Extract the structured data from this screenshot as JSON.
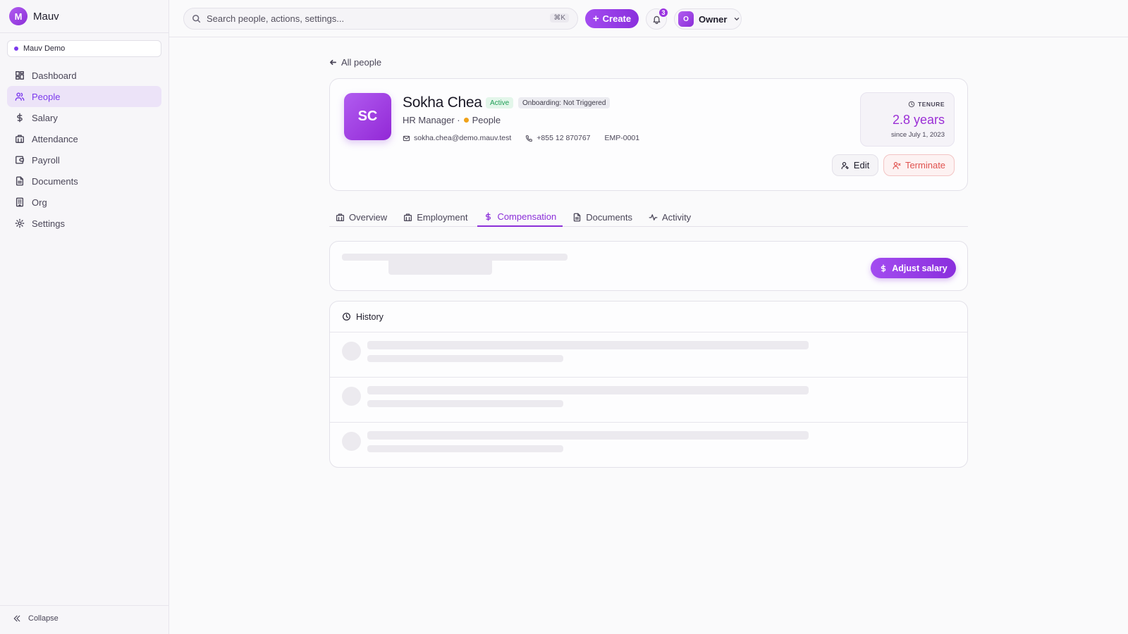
{
  "app": {
    "name": "Mauv",
    "logo_letter": "M"
  },
  "workspace": {
    "name": "Mauv Demo",
    "dot_color": "#7c3aed"
  },
  "sidebar": {
    "items": [
      {
        "label": "Dashboard",
        "icon": "dashboard-icon",
        "active": false
      },
      {
        "label": "People",
        "icon": "people-icon",
        "active": true
      },
      {
        "label": "Salary",
        "icon": "dollar-icon",
        "active": false
      },
      {
        "label": "Attendance",
        "icon": "attendance-icon",
        "active": false
      },
      {
        "label": "Payroll",
        "icon": "wallet-icon",
        "active": false
      },
      {
        "label": "Documents",
        "icon": "document-icon",
        "active": false
      },
      {
        "label": "Org",
        "icon": "org-icon",
        "active": false
      },
      {
        "label": "Settings",
        "icon": "gear-icon",
        "active": false
      }
    ],
    "collapse_label": "Collapse"
  },
  "topbar": {
    "search_placeholder": "Search people, actions, settings...",
    "search_shortcut": "⌘K",
    "create_label": "Create",
    "notification_count": "3",
    "user": {
      "initial": "O",
      "name": "Owner"
    }
  },
  "back_link": "All people",
  "profile": {
    "initials": "SC",
    "name": "Sokha Chea",
    "status": "Active",
    "onboarding": "Onboarding: Not Triggered",
    "role": "HR Manager ·",
    "department": "People",
    "email": "sokha.chea@demo.mauv.test",
    "phone": "+855 12 870767",
    "employee_id": "EMP-0001",
    "tenure": {
      "label": "TENURE",
      "value": "2.8 years",
      "since": "since July 1, 2023"
    },
    "edit_label": "Edit",
    "terminate_label": "Terminate"
  },
  "tabs": [
    {
      "label": "Overview",
      "icon": "briefcase-icon",
      "active": false
    },
    {
      "label": "Employment",
      "icon": "briefcase-icon",
      "active": false
    },
    {
      "label": "Compensation",
      "icon": "dollar-icon",
      "active": true
    },
    {
      "label": "Documents",
      "icon": "document-icon",
      "active": false
    },
    {
      "label": "Activity",
      "icon": "activity-icon",
      "active": false
    }
  ],
  "compensation": {
    "adjust_label": "Adjust salary"
  },
  "history": {
    "title": "History"
  },
  "colors": {
    "accent": "#8b2fd8",
    "danger": "#e0524f",
    "success": "#1f9d55"
  }
}
